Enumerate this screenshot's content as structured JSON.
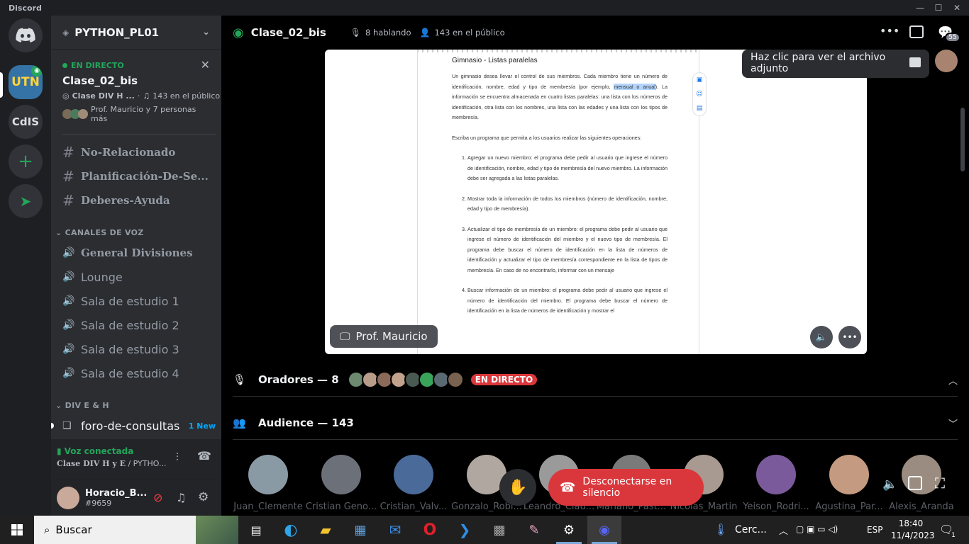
{
  "app": {
    "brand": "Discord"
  },
  "window_controls": {
    "minimize": "—",
    "maximize": "☐",
    "close": "✕"
  },
  "rail": {
    "servers": [
      {
        "name": "UTN"
      },
      {
        "name": "CdIS"
      }
    ],
    "badge_active": "UTN"
  },
  "server": {
    "name": "PYTHON_PL01"
  },
  "live_card": {
    "status": "EN DIRECTO",
    "title": "Clase_02_bis",
    "channel": "Clase DIV H ...",
    "audience": "143 en el público",
    "speakers": "Prof. Mauricio y 7 personas más"
  },
  "text_channels": [
    {
      "name": "No-Relacionado"
    },
    {
      "name": "Planificación-De-Se..."
    },
    {
      "name": "Deberes-Ayuda"
    }
  ],
  "voice_category": "CANALES DE VOZ",
  "voice_channels": [
    {
      "name": "General Divisiones"
    },
    {
      "name": "Lounge"
    },
    {
      "name": "Sala de estudio 1"
    },
    {
      "name": "Sala de estudio 2"
    },
    {
      "name": "Sala de estudio 3"
    },
    {
      "name": "Sala de estudio 4"
    }
  ],
  "category2": "DIV E & H",
  "forum": {
    "name": "foro-de-consultas",
    "badge": "1 New"
  },
  "voice_status": {
    "label": "Voz conectada",
    "channel": "Clase DIV H y E",
    "server": " / PYTHO..."
  },
  "user": {
    "name": "Horacio_B...",
    "tag": "#9659"
  },
  "stage": {
    "title": "Clase_02_bis",
    "speaking": "8 hablando",
    "public": "143 en el público",
    "inbox_badge": "55",
    "attachment_tip": "Haz clic para ver el archivo adjunto",
    "presenter": "Prof. Mauricio"
  },
  "document": {
    "title": "Gimnasio - Listas paralelas",
    "intro_before": "Un gimnasio desea llevar el control de sus miembros. Cada miembro tiene un número de identificación, nombre, edad y tipo de membresía (por ejemplo, ",
    "intro_highlight": "mensual o anual",
    "intro_after": "). La información se encuentra almacenada en cuatro listas paralelas: una lista con los números de identificación, otra lista con los nombres, una lista con las edades y una lista con los tipos de membresía.",
    "task": "Escriba un programa que permita a los usuarios realizar las siguientes operaciones:",
    "items": [
      "Agregar un nuevo miembro: el programa debe pedir al usuario que ingrese el número de identificación, nombre, edad y tipo de membresía del nuevo miembro. La información debe ser agregada a las listas paralelas.",
      "Mostrar toda la información de todos los miembros (número de identificación, nombre, edad y tipo de membresía).",
      "Actualizar el tipo de membresía de un miembro: el programa debe pedir al usuario que ingrese el número de identificación del miembro y el nuevo tipo de membresía. El programa debe buscar el número de identificación en la lista de números de identificación y actualizar el tipo de membresía correspondiente en la lista de tipos de membresía. En caso de no encontrarlo, informar con un mensaje",
      "Buscar información de un miembro: el programa debe pedir al usuario que ingrese el número de identificación del miembro. El programa debe buscar el número de identificación en la lista de números de identificación y mostrar el"
    ]
  },
  "speakers_row": {
    "label": "Oradores — 8",
    "live": "EN DIRECTO"
  },
  "audience_row": {
    "label": "Audience — 143"
  },
  "audience": [
    {
      "name": "Juan_Clemente"
    },
    {
      "name": "Cristian Geno..."
    },
    {
      "name": "Cristian_Valv..."
    },
    {
      "name": "Gonzalo_Robl..."
    },
    {
      "name": "Leandro_Clau..."
    },
    {
      "name": "Mariano_Past..."
    },
    {
      "name": "Nicolas_Martin"
    },
    {
      "name": "Yeison_Rodri..."
    },
    {
      "name": "Agustina_Par..."
    },
    {
      "name": "Alexis_Aranda"
    }
  ],
  "disconnect_button": "Desconectarse en silencio",
  "taskbar": {
    "search": "Buscar",
    "weather": "Cerc...",
    "lang": "ESP",
    "time": "18:40",
    "date": "11/4/2023",
    "notif_count": "1"
  },
  "colors": {
    "accent": "#23a55a",
    "danger": "#da373c",
    "blurple": "#5865f2"
  }
}
